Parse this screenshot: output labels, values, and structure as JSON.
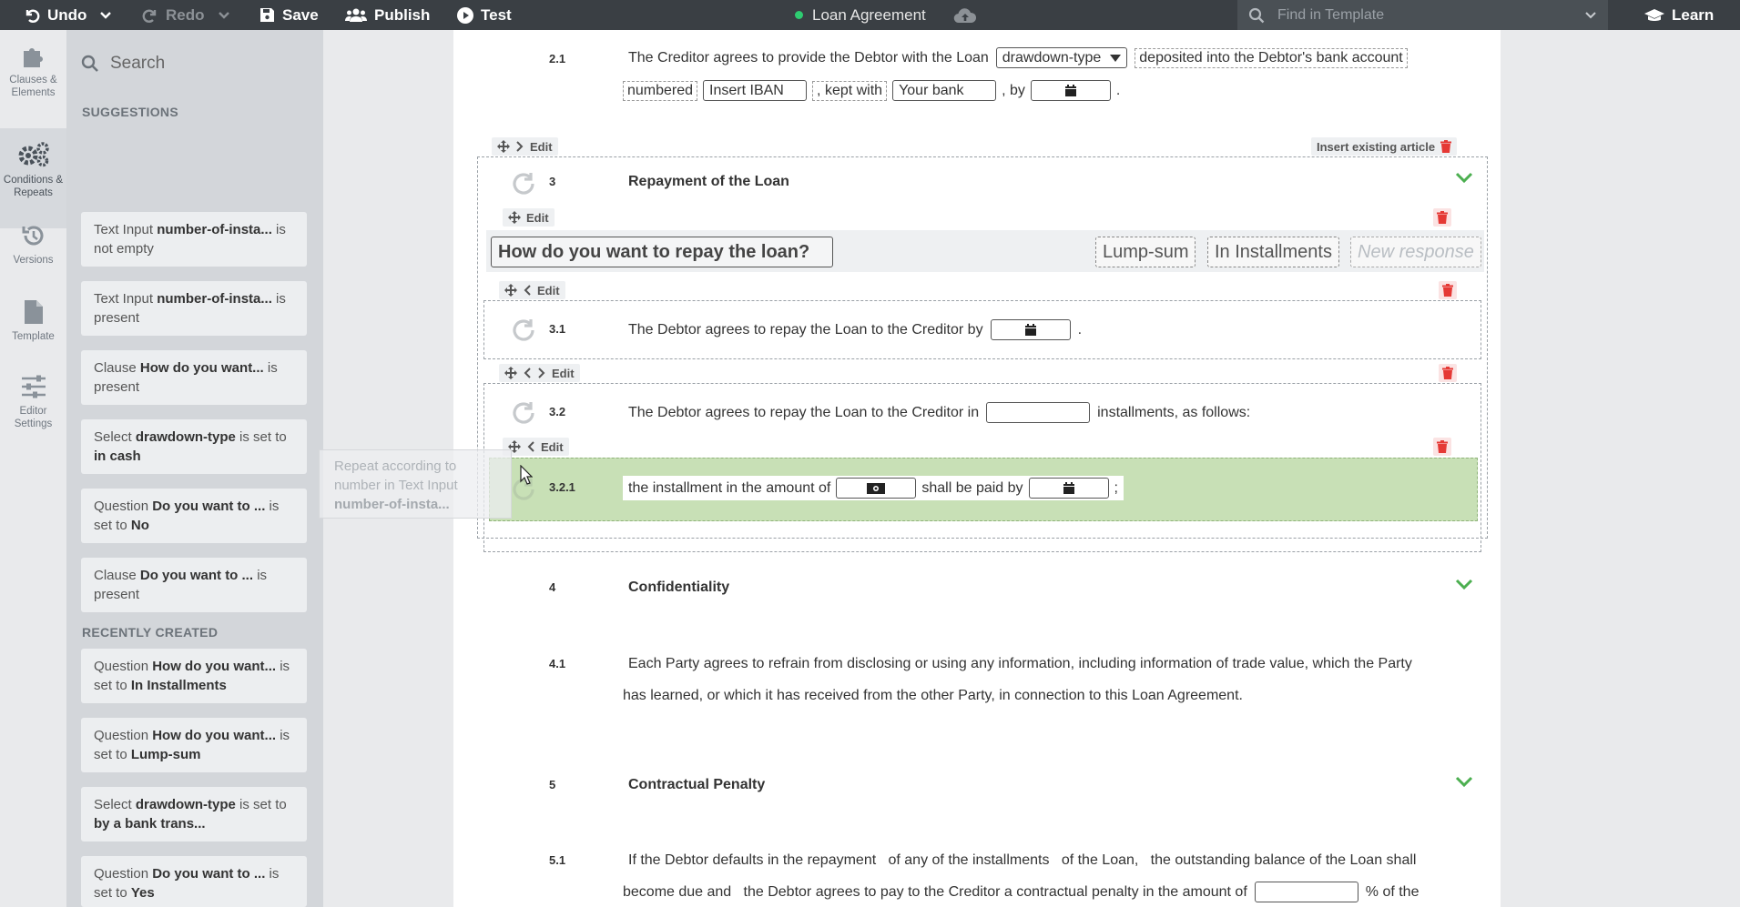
{
  "topbar": {
    "undo": "Undo",
    "redo": "Redo",
    "save": "Save",
    "publish": "Publish",
    "test": "Test",
    "doc_title": "Loan Agreement",
    "find_placeholder": "Find in Template",
    "learn": "Learn"
  },
  "rail": [
    {
      "label": "Clauses & Elements",
      "icon": "puzzle-icon"
    },
    {
      "label": "Conditions & Repeats",
      "icon": "gears-icon"
    },
    {
      "label": "Versions",
      "icon": "history-icon"
    },
    {
      "label": "Template",
      "icon": "file-icon"
    },
    {
      "label": "Editor Settings",
      "icon": "sliders-icon"
    }
  ],
  "sidebar": {
    "search_placeholder": "Search",
    "suggestions_header": "SUGGESTIONS",
    "suggestions": [
      {
        "pre": "Text Input ",
        "bold": "number-of-insta...",
        "post": " is not empty"
      },
      {
        "pre": "Text Input ",
        "bold": "number-of-insta...",
        "post": " is present"
      },
      {
        "pre": "Clause ",
        "bold": "How do you want...",
        "post": " is present"
      },
      {
        "pre": "Select ",
        "bold": "drawdown-type",
        "post": " is set to ",
        "bold2": "in cash"
      },
      {
        "pre": "Question ",
        "bold": "Do you want to ...",
        "post": " is set to ",
        "bold2": "No"
      },
      {
        "pre": "Clause ",
        "bold": "Do you want to ...",
        "post": " is present"
      }
    ],
    "recent_header": "RECENTLY CREATED",
    "recent": [
      {
        "pre": "Question ",
        "bold": "How do you want...",
        "post": " is set to ",
        "bold2": "In Installments"
      },
      {
        "pre": "Question ",
        "bold": "How do you want...",
        "post": " is set to ",
        "bold2": "Lump-sum"
      },
      {
        "pre": "Select ",
        "bold": "drawdown-type",
        "post": " is set to ",
        "bold2": "by a bank trans..."
      },
      {
        "pre": "Question ",
        "bold": "Do you want to ...",
        "post": " is set to ",
        "bold2": "Yes"
      }
    ]
  },
  "drag_ghost": {
    "pre": "Repeat according to number in Text Input ",
    "bold": "number-of-insta..."
  },
  "document": {
    "s2_1": {
      "num": "2.1",
      "t1": "The Creditor agrees to provide the Debtor with the Loan",
      "dropdown": "drawdown-type",
      "t2": "deposited into the Debtor's bank account",
      "t3": "numbered",
      "iban": "Insert IBAN",
      "t4": ", kept with",
      "bank": "Your bank",
      "t5": ", by",
      "t6": "."
    },
    "edit": "Edit",
    "insert_existing": "Insert existing article",
    "s3": {
      "num": "3",
      "title": "Repayment of the Loan"
    },
    "question": "How do you want to repay the loan?",
    "responses": [
      "Lump-sum",
      "In Installments"
    ],
    "new_response": "New response",
    "s3_1": {
      "num": "3.1",
      "t1": "The Debtor agrees to repay the Loan to the Creditor by",
      "t2": "."
    },
    "s3_2": {
      "num": "3.2",
      "t1": "The Debtor agrees to repay the Loan to the Creditor in",
      "t2": "installments, as follows:"
    },
    "s3_2_1": {
      "num": "3.2.1",
      "t1": "the installment in the amount of",
      "t2": "shall be paid by",
      "t3": ";"
    },
    "s4": {
      "num": "4",
      "title": "Confidentiality"
    },
    "s4_1": {
      "num": "4.1",
      "t1": "Each Party agrees to refrain from disclosing or using any information, including information of trade value, which the Party",
      "t2": "has learned, or which it has received from the other Party, in connection to this Loan Agreement."
    },
    "s5": {
      "num": "5",
      "title": "Contractual Penalty"
    },
    "s5_1": {
      "num": "5.1",
      "t1": "If the Debtor defaults in the repayment   of any of the installments   of the Loan,   the outstanding balance of the Loan shall",
      "t2": "become due and   the Debtor agrees to pay to the Creditor a contractual penalty in the amount of",
      "t3": "% of the"
    }
  },
  "colors": {
    "topbar": "#3a3f44",
    "sidebar": "#d3d6da",
    "highlight": "#c8e0b6",
    "accent_green": "#4caf50",
    "trash_red": "#e53935"
  }
}
